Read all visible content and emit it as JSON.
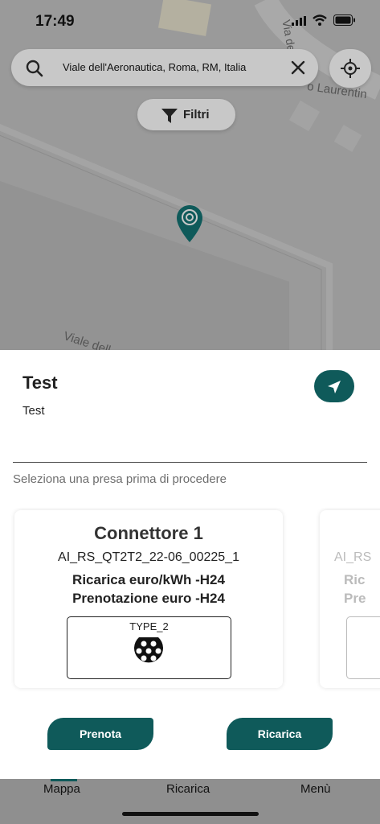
{
  "status_bar": {
    "time": "17:49"
  },
  "map": {
    "street_labels": [
      "Via de",
      "o Laurentin",
      "Viale dell"
    ],
    "pin_icon": "charging-station-pin-icon"
  },
  "search": {
    "value": "Viale dell'Aeronautica, Roma, RM, Italia",
    "icon": "search-icon"
  },
  "filter": {
    "label": "Filtri",
    "icon": "filter-icon"
  },
  "station": {
    "name": "Test",
    "description": "Test",
    "instruction": "Seleziona una presa prima di procedere"
  },
  "connectors": [
    {
      "title": "Connettore 1",
      "code": "AI_RS_QT2T2_22-06_00225_1",
      "tariff_charge": "Ricarica euro/kWh -H24",
      "tariff_booking": "Prenotazione euro -H24",
      "plug_type": "TYPE_2"
    },
    {
      "code": "AI_RS",
      "tariff_charge": "Ric",
      "tariff_booking": "Pre"
    }
  ],
  "actions": {
    "book": "Prenota",
    "charge": "Ricarica"
  },
  "tabbar": {
    "map": "Mappa",
    "charge": "Ricarica",
    "menu": "Menù"
  },
  "colors": {
    "accent": "#0f5a5a",
    "overlay": "#8f8f8f"
  }
}
